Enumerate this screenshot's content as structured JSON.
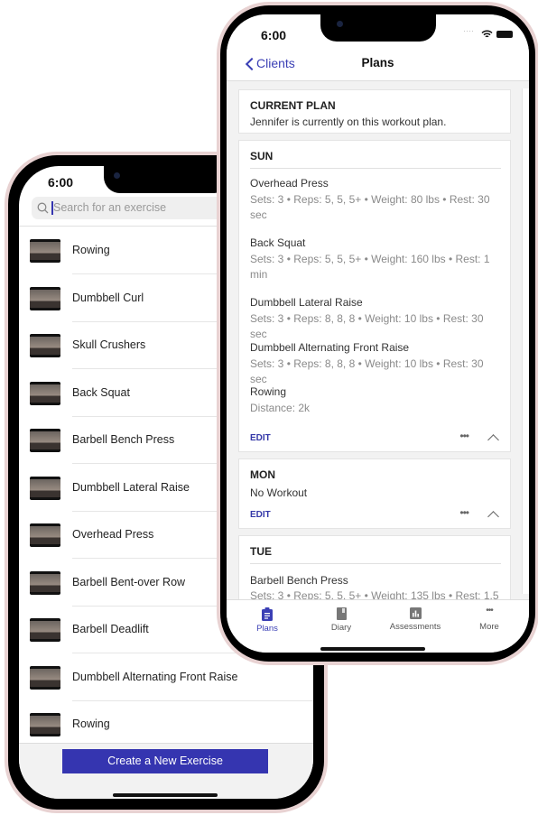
{
  "left_phone": {
    "status_time": "6:00",
    "search": {
      "placeholder": "Search for an exercise",
      "icon": "search-icon"
    },
    "exercises": [
      "Rowing",
      "Dumbbell Curl",
      "Skull Crushers",
      "Back Squat",
      "Barbell Bench Press",
      "Dumbbell Lateral Raise",
      "Overhead Press",
      "Barbell Bent-over Row",
      "Barbell Deadlift",
      "Dumbbell Alternating Front Raise",
      "Rowing"
    ],
    "create_button": "Create a New Exercise",
    "accent": "#3535b0"
  },
  "right_phone": {
    "status_time": "6:00",
    "nav": {
      "back_label": "Clients",
      "title": "Plans"
    },
    "current_plan": {
      "heading": "CURRENT PLAN",
      "text": "Jennifer is currently on this workout plan."
    },
    "days": [
      {
        "day": "SUN",
        "exercises": [
          {
            "name": "Overhead Press",
            "details": "Sets: 3 • Reps: 5, 5, 5+ • Weight: 80 lbs • Rest: 30 sec"
          },
          {
            "name": "Back Squat",
            "details": "Sets: 3 • Reps: 5, 5, 5+ • Weight: 160 lbs • Rest: 1 min"
          },
          {
            "name": "Dumbbell Lateral Raise",
            "details": "Sets: 3 • Reps: 8, 8, 8 • Weight: 10 lbs • Rest: 30 sec"
          },
          {
            "name": "Dumbbell Alternating Front Raise",
            "details": "Sets: 3 • Reps: 8, 8, 8 • Weight: 10 lbs • Rest: 30 sec"
          },
          {
            "name": "Rowing",
            "details": "Distance: 2k"
          }
        ],
        "edit": "EDIT"
      },
      {
        "day": "MON",
        "note": "No Workout",
        "edit": "EDIT"
      },
      {
        "day": "TUE",
        "exercises": [
          {
            "name": "Barbell Bench Press",
            "details": "Sets: 3 • Reps: 5, 5, 5+ • Weight: 135 lbs • Rest: 1.5"
          }
        ]
      }
    ],
    "tabs": [
      {
        "label": "Plans",
        "icon": "clipboard-icon",
        "active": true
      },
      {
        "label": "Diary",
        "icon": "book-icon"
      },
      {
        "label": "Assessments",
        "icon": "bar-chart-icon"
      },
      {
        "label": "More",
        "icon": "more-icon"
      }
    ],
    "accent": "#3a3fb5"
  }
}
